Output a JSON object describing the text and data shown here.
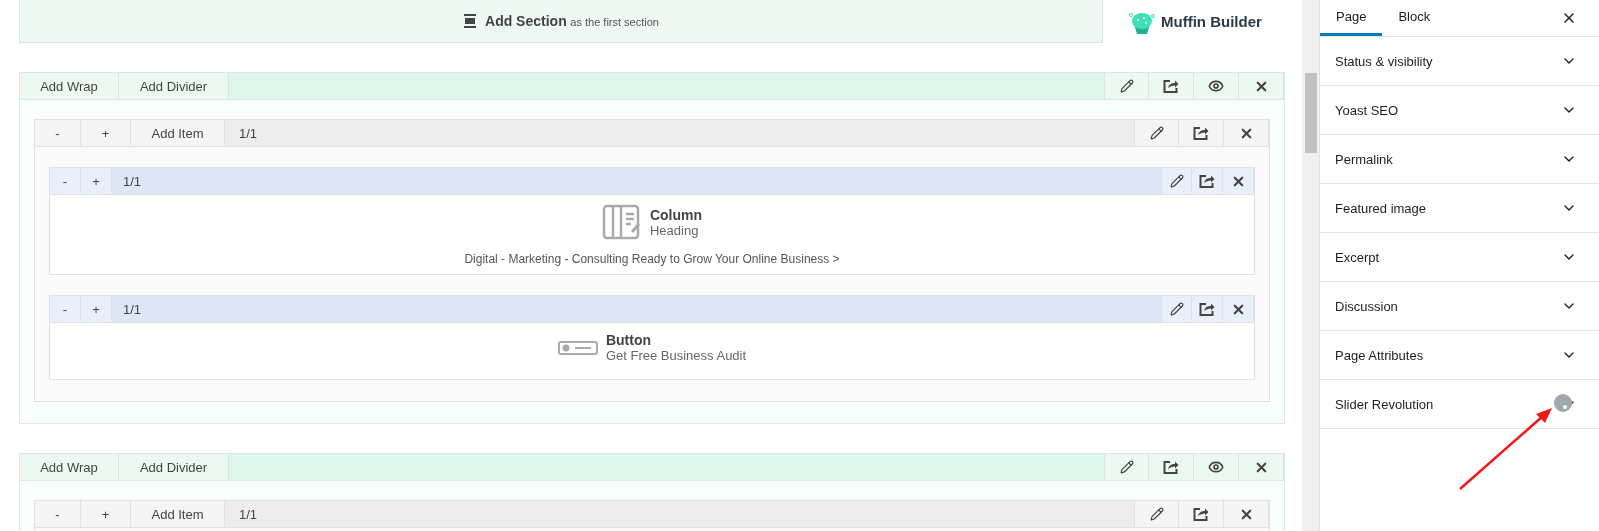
{
  "top_bar": {
    "label": "Add Section",
    "suffix": "as the first section"
  },
  "logo": {
    "text": "Muffin Builder"
  },
  "sections": [
    {
      "buttons": [
        "Add Wrap",
        "Add Divider"
      ],
      "wraps": [
        {
          "size_buttons": [
            "-",
            "+"
          ],
          "add_item": "Add Item",
          "size": "1/1",
          "items": [
            {
              "kind": "column",
              "size_buttons": [
                "-",
                "+"
              ],
              "size": "1/1",
              "title": "Column",
              "subtitle": "Heading",
              "text": "Digital - Marketing - Consulting Ready to Grow Your Online Business >"
            },
            {
              "kind": "button",
              "size_buttons": [
                "-",
                "+"
              ],
              "size": "1/1",
              "title": "Button",
              "subtitle": "Get Free Business Audit"
            }
          ]
        }
      ]
    },
    {
      "buttons": [
        "Add Wrap",
        "Add Divider"
      ],
      "wraps": [
        {
          "size_buttons": [
            "-",
            "+"
          ],
          "add_item": "Add Item",
          "size": "1/1"
        }
      ]
    }
  ],
  "sidebar": {
    "tabs": [
      {
        "label": "Page",
        "selected": true
      },
      {
        "label": "Block",
        "selected": false
      }
    ],
    "panels": [
      {
        "title": "Status & visibility",
        "expanded": false
      },
      {
        "title": "Yoast SEO",
        "expanded": false
      },
      {
        "title": "Permalink",
        "expanded": false
      },
      {
        "title": "Featured image",
        "expanded": false
      },
      {
        "title": "Excerpt",
        "expanded": false
      },
      {
        "title": "Discussion",
        "expanded": false
      },
      {
        "title": "Page Attributes",
        "expanded": false
      },
      {
        "title": "Slider Revolution",
        "expanded": false
      }
    ]
  }
}
